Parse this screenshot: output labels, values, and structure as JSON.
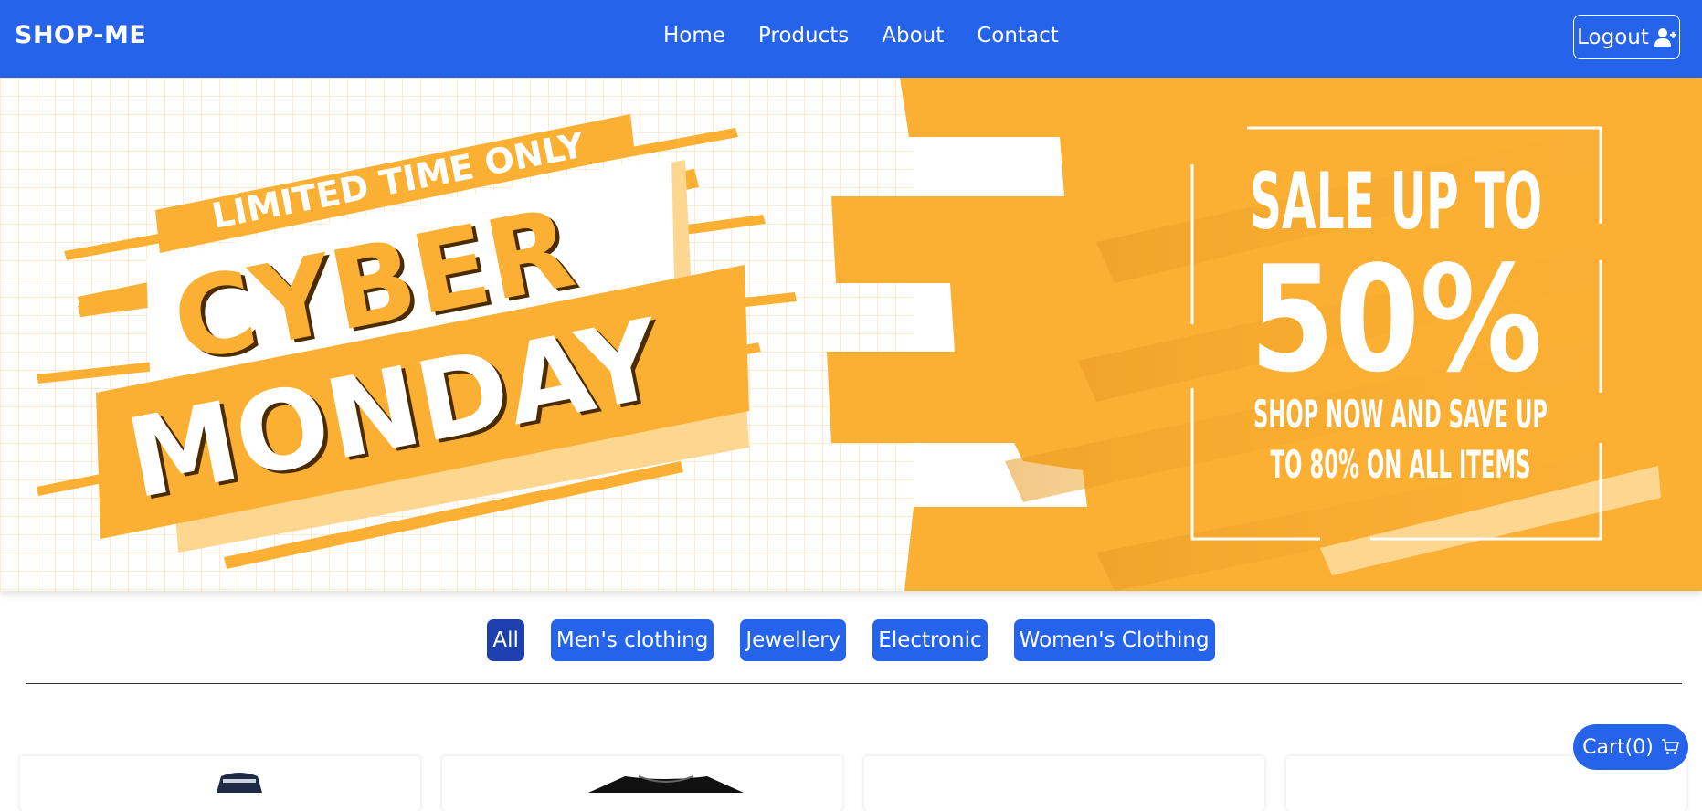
{
  "navbar": {
    "brand": "SHOP-ME",
    "links": [
      {
        "label": "Home"
      },
      {
        "label": "Products"
      },
      {
        "label": "About"
      },
      {
        "label": "Contact"
      }
    ],
    "logout_label": "Logout",
    "logout_icon": "user-plus-icon"
  },
  "hero": {
    "tagline": "LIMITED TIME ONLY",
    "headline_1": "CYBER",
    "headline_2": "MONDAY",
    "sale_line": "SALE UP TO",
    "sale_percent": "50%",
    "sub_line_1": "SHOP NOW AND SAVE UP",
    "sub_line_2": "TO 80% ON ALL ITEMS"
  },
  "filters": {
    "items": [
      {
        "label": "All",
        "active": true
      },
      {
        "label": "Men's clothing",
        "active": false
      },
      {
        "label": "Jewellery",
        "active": false
      },
      {
        "label": "Electronic",
        "active": false
      },
      {
        "label": "Women's Clothing",
        "active": false
      }
    ]
  },
  "cart": {
    "label": "Cart(0)",
    "icon": "cart-icon"
  },
  "colors": {
    "primary": "#2563eb",
    "primary_active": "#1e40af",
    "banner_orange": "#fbb034",
    "banner_light_orange": "#fdd68f"
  }
}
